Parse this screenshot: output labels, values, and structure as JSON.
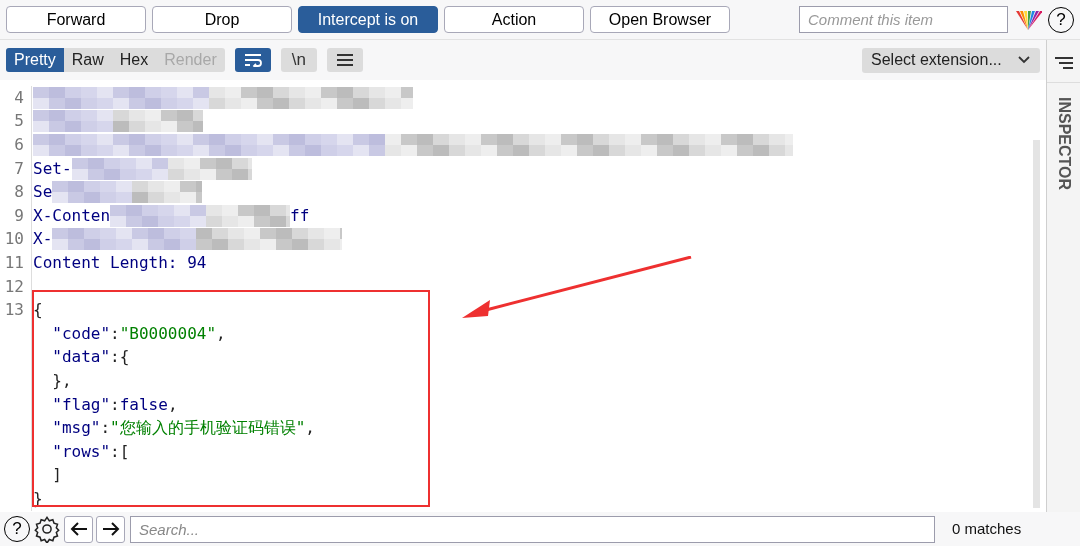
{
  "toolbar": {
    "buttons": [
      {
        "label": "Forward",
        "selected": false
      },
      {
        "label": "Drop",
        "selected": false
      },
      {
        "label": "Intercept is on",
        "selected": true
      },
      {
        "label": "Action",
        "selected": false
      },
      {
        "label": "Open Browser",
        "selected": false
      }
    ],
    "comment": {
      "placeholder": "Comment this item"
    },
    "help": "?"
  },
  "view_tabs": [
    {
      "label": "Pretty",
      "selected": true,
      "disabled": false
    },
    {
      "label": "Raw",
      "selected": false,
      "disabled": false
    },
    {
      "label": "Hex",
      "selected": false,
      "disabled": false
    },
    {
      "label": "Render",
      "selected": false,
      "disabled": true
    }
  ],
  "view_buttons": [
    {
      "kind": "wrap",
      "on": true
    },
    {
      "kind": "newline",
      "label": "\\n",
      "on": false
    },
    {
      "kind": "menu",
      "on": false
    }
  ],
  "extension_select": "Select extension...",
  "inspector": "INSPECTOR",
  "lines": [
    {
      "num": "4",
      "kind": "redacted"
    },
    {
      "num": "5",
      "kind": "redacted"
    },
    {
      "num": "6",
      "kind": "redacted"
    },
    {
      "num": "7",
      "kind": "redacted",
      "tokens": [
        {
          "kind": "key",
          "text": "Set-"
        }
      ]
    },
    {
      "num": "8",
      "kind": "redacted",
      "tokens": [
        {
          "kind": "key",
          "text": "Se"
        }
      ]
    },
    {
      "num": "9",
      "kind": "redacted",
      "tokens": [
        {
          "kind": "key",
          "text": "X-Conten"
        }
      ],
      "tail": "ff"
    },
    {
      "num": "10",
      "kind": "redacted",
      "tokens": [
        {
          "kind": "key",
          "text": "X-"
        }
      ]
    },
    {
      "num": "11",
      "kind": "code",
      "tokens": [
        {
          "kind": "key",
          "text": "Content Length: 94"
        }
      ]
    },
    {
      "num": "12",
      "kind": "code"
    },
    {
      "num": "13",
      "kind": "code",
      "tokens": [
        {
          "kind": "punct",
          "text": "{"
        }
      ]
    },
    {
      "kind": "code",
      "tokens": [
        {
          "kind": "key",
          "text": "  \"code\""
        },
        {
          "kind": "punct",
          "text": ":"
        },
        {
          "kind": "string",
          "text": "\"B0000004\""
        },
        {
          "kind": "punct",
          "text": ","
        }
      ]
    },
    {
      "kind": "code",
      "tokens": [
        {
          "kind": "key",
          "text": "  \"data\""
        },
        {
          "kind": "punct",
          "text": ":{"
        }
      ]
    },
    {
      "kind": "code",
      "tokens": [
        {
          "kind": "punct",
          "text": "  },"
        }
      ]
    },
    {
      "kind": "code",
      "tokens": [
        {
          "kind": "key",
          "text": "  \"flag\""
        },
        {
          "kind": "punct",
          "text": ":"
        },
        {
          "kind": "key",
          "text": "false"
        },
        {
          "kind": "punct",
          "text": ","
        }
      ]
    },
    {
      "kind": "code",
      "tokens": [
        {
          "kind": "key",
          "text": "  \"msg\""
        },
        {
          "kind": "punct",
          "text": ":"
        },
        {
          "kind": "string",
          "text": "\"您输入的手机验证码错误\""
        },
        {
          "kind": "punct",
          "text": ","
        }
      ]
    },
    {
      "kind": "code",
      "tokens": [
        {
          "kind": "key",
          "text": "  \"rows\""
        },
        {
          "kind": "punct",
          "text": ":["
        }
      ]
    },
    {
      "kind": "code",
      "tokens": [
        {
          "kind": "punct",
          "text": "  ]"
        }
      ]
    },
    {
      "kind": "code",
      "tokens": [
        {
          "kind": "punct",
          "text": "}"
        }
      ]
    }
  ],
  "search": {
    "placeholder": "Search...",
    "matches": "0 matches"
  }
}
